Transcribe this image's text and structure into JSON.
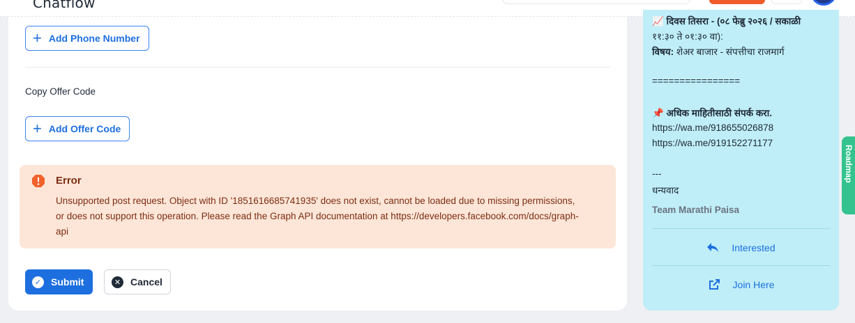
{
  "header": {
    "brand": "Chatflow"
  },
  "form": {
    "add_phone_label": "Add Phone Number",
    "offer_code_label": "Copy Offer Code",
    "add_offer_label": "Add Offer Code",
    "error": {
      "title": "Error",
      "message": "Unsupported post request. Object with ID '1851616685741935' does not exist, cannot be loaded due to missing permissions, or does not support this operation. Please read the Graph API documentation at https://developers.facebook.com/docs/graph-api"
    },
    "submit_label": "Submit",
    "cancel_label": "Cancel"
  },
  "preview": {
    "line_day": "📈 दिवस तिसरा - (०८ फेब्रु २०२६ / सकाळी",
    "line_time": "११:३० ते ०१:३० वा):",
    "subject_prefix": "विषय:",
    "subject_text": " शेअर बाजार - संपत्तीचा राजमार्ग",
    "separator": "================",
    "contact_heading": "📌 अधिक माहितीसाठी संपर्क करा.",
    "link1": "https://wa.me/918655026878",
    "link2": "https://wa.me/919152271177",
    "dashes": "---",
    "thanks": "धन्यवाद",
    "team": "Team Marathi Paisa",
    "action_interested": "Interested",
    "action_join": "Join Here"
  },
  "side_tab": {
    "label": "Roadmap"
  },
  "colors": {
    "primary": "#1d6fe0",
    "error_bg": "#fde6d8",
    "error_text": "#7c2d12",
    "error_icon": "#f2622b",
    "preview_bg": "#bfeef8",
    "roadmap_tab": "#34c38f",
    "brand_button": "#f25c2b"
  },
  "icons": {
    "add": "plus-icon",
    "error": "error-octagon-icon",
    "submit": "check-circle-icon",
    "cancel": "x-circle-icon",
    "interested": "reply-icon",
    "join": "external-link-icon"
  }
}
